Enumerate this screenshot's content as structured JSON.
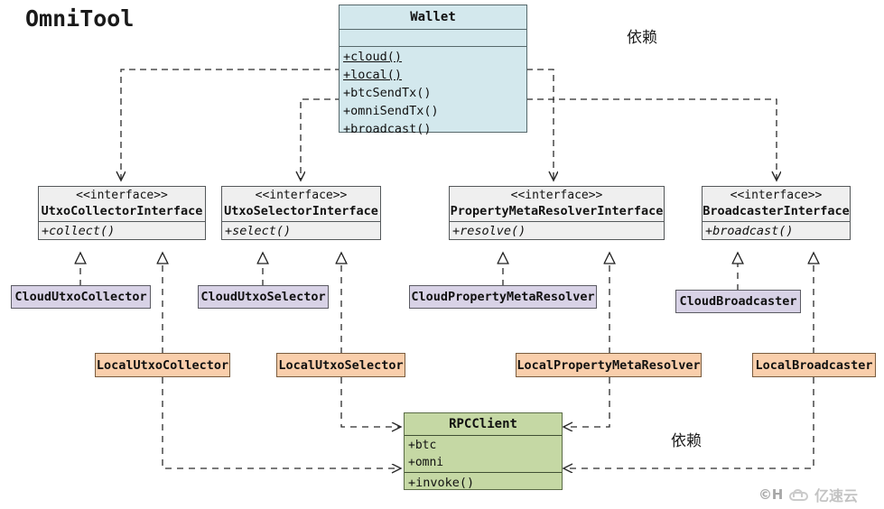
{
  "diagram": {
    "title": "OmniTool",
    "type": "uml-class-diagram"
  },
  "classes": {
    "wallet": {
      "name": "Wallet",
      "attributes": [],
      "operations": [
        {
          "label": "+cloud()",
          "static": true
        },
        {
          "label": "+local()",
          "static": true
        },
        {
          "label": "+btcSendTx()",
          "static": false
        },
        {
          "label": "+omniSendTx()",
          "static": false
        },
        {
          "label": "+broadcast()",
          "static": false
        }
      ],
      "fill": "#d3e8ed"
    },
    "rpcclient": {
      "name": "RPCClient",
      "attributes": [
        "+btc",
        "+omni"
      ],
      "operations": [
        "+invoke()"
      ],
      "fill": "#c5d8a4"
    }
  },
  "interfaces": [
    {
      "stereotype": "<<interface>>",
      "name": "UtxoCollectorInterface",
      "operation": "+collect()",
      "fill": "#efefef"
    },
    {
      "stereotype": "<<interface>>",
      "name": "UtxoSelectorInterface",
      "operation": "+select()",
      "fill": "#efefef"
    },
    {
      "stereotype": "<<interface>>",
      "name": "PropertyMetaResolverInterface",
      "operation": "+resolve()",
      "fill": "#efefef"
    },
    {
      "stereotype": "<<interface>>",
      "name": "BroadcasterInterface",
      "operation": "+broadcast()",
      "fill": "#efefef"
    }
  ],
  "cloud_implementations": [
    {
      "name": "CloudUtxoCollector",
      "fill": "#d8d2e6"
    },
    {
      "name": "CloudUtxoSelector",
      "fill": "#d8d2e6"
    },
    {
      "name": "CloudPropertyMetaResolver",
      "fill": "#d8d2e6"
    },
    {
      "name": "CloudBroadcaster",
      "fill": "#d8d2e6"
    }
  ],
  "local_implementations": [
    {
      "name": "LocalUtxoCollector",
      "fill": "#f9ceab"
    },
    {
      "name": "LocalUtxoSelector",
      "fill": "#f9ceab"
    },
    {
      "name": "LocalPropertyMetaResolver",
      "fill": "#f9ceab"
    },
    {
      "name": "LocalBroadcaster",
      "fill": "#f9ceab"
    }
  ],
  "annotations": [
    {
      "text": "依赖",
      "meaning": "dependency"
    },
    {
      "text": "依赖",
      "meaning": "dependency"
    }
  ],
  "watermark": {
    "copyright": "©H",
    "brand": "亿速云"
  }
}
